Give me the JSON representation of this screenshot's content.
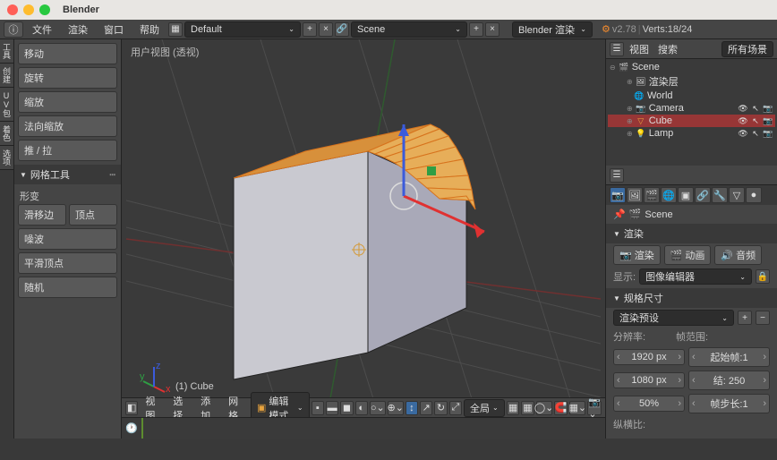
{
  "app": {
    "title": "Blender"
  },
  "header": {
    "file": "文件",
    "render": "渲染",
    "window": "窗口",
    "help": "帮助",
    "layout_name": "Default",
    "scene_name": "Scene",
    "engine": "Blender 渲染",
    "version": "v2.78",
    "stats": "Verts:18/24"
  },
  "toolpanel": {
    "move": "移动",
    "rotate": "旋转",
    "scale": "缩放",
    "normal_scale": "法向缩放",
    "push_pull": "推 / 拉",
    "header_mesh": "网格工具",
    "deform": "形变",
    "slide_edge": "滑移边",
    "vertex": "顶点",
    "noise": "噪波",
    "smooth_vertex": "平滑顶点",
    "random": "随机"
  },
  "viewport": {
    "persp_label": "用户视图  (透视)",
    "object_label": "(1) Cube",
    "view": "视图",
    "select": "选择",
    "add": "添加",
    "mesh": "网格",
    "mode": "编辑模式",
    "orientation": "全局"
  },
  "outliner": {
    "view": "视图",
    "search": "搜索",
    "all_scenes": "所有场景",
    "scene": "Scene",
    "render_layers": "渲染层",
    "world": "World",
    "camera": "Camera",
    "cube": "Cube",
    "lamp": "Lamp"
  },
  "props": {
    "scene_name": "Scene",
    "render_hdr": "渲染",
    "render_btn": "渲染",
    "anim_btn": "动画",
    "audio_btn": "音频",
    "display_label": "显示:",
    "display_value": "图像编辑器",
    "dim_hdr": "规格尺寸",
    "preset": "渲染预设",
    "res_label": "分辨率:",
    "res_x": "1920 px",
    "res_y": "1080 px",
    "res_pct": "50%",
    "frames_label": "帧范围:",
    "frame_start": "起始帧:1",
    "frame_end": "结:  250",
    "frame_step": "帧步长:1",
    "aspect_label": "纵横比:"
  }
}
